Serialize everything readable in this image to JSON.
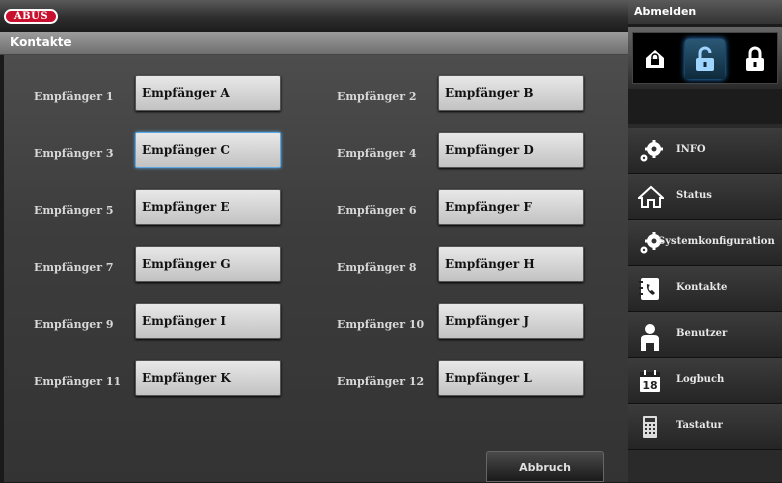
{
  "header": {
    "logo_text": "ABUS"
  },
  "page": {
    "title": "Kontakte"
  },
  "contacts": [
    {
      "label": "Empfänger 1",
      "value": "Empfänger A"
    },
    {
      "label": "Empfänger 2",
      "value": "Empfänger B"
    },
    {
      "label": "Empfänger 3",
      "value": "Empfänger C"
    },
    {
      "label": "Empfänger 4",
      "value": "Empfänger D"
    },
    {
      "label": "Empfänger 5",
      "value": "Empfänger E"
    },
    {
      "label": "Empfänger 6",
      "value": "Empfänger F"
    },
    {
      "label": "Empfänger 7",
      "value": "Empfänger G"
    },
    {
      "label": "Empfänger 8",
      "value": "Empfänger H"
    },
    {
      "label": "Empfänger 9",
      "value": "Empfänger I"
    },
    {
      "label": "Empfänger 10",
      "value": "Empfänger J"
    },
    {
      "label": "Empfänger 11",
      "value": "Empfänger K"
    },
    {
      "label": "Empfänger 12",
      "value": "Empfänger L"
    }
  ],
  "actions": {
    "cancel_label": "Abbruch"
  },
  "sidebar": {
    "logout_label": "Abmelden",
    "lock_modes": [
      "home-lock-icon",
      "unlock-icon",
      "lock-icon"
    ],
    "nav": [
      {
        "label": "INFO",
        "icon": "gears-icon"
      },
      {
        "label": "Status",
        "icon": "house-icon"
      },
      {
        "label": "Systemkonfiguration",
        "icon": "gears-icon"
      },
      {
        "label": "Kontakte",
        "icon": "phonebook-icon"
      },
      {
        "label": "Benutzer",
        "icon": "user-icon"
      },
      {
        "label": "Logbuch",
        "icon": "calendar-icon"
      },
      {
        "label": "Tastatur",
        "icon": "keypad-icon"
      }
    ]
  },
  "colors": {
    "accent": "#3aa0ff",
    "brand": "#c8102e"
  }
}
